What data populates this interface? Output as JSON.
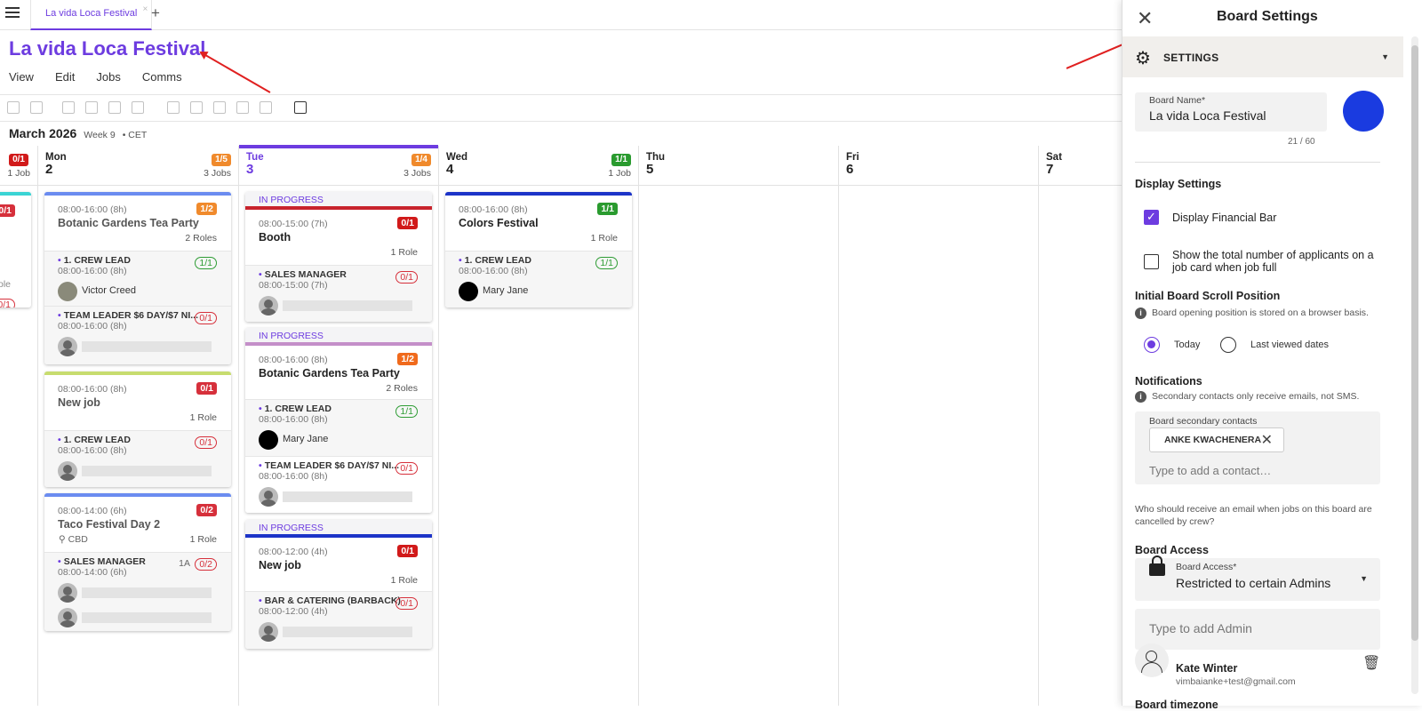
{
  "tab": {
    "label": "La vida Loca Festival",
    "close": "×",
    "add": "+"
  },
  "board": {
    "title": "La vida Loca Festival"
  },
  "menu": [
    "View",
    "Edit",
    "Jobs",
    "Comms"
  ],
  "datebar": {
    "month": "March 2026",
    "week": "Week 9",
    "tz": "• CET"
  },
  "days": [
    {
      "name": "",
      "num": "",
      "badge": "0/1",
      "badge_color": "#d11a1a",
      "jobs": "1 Job"
    },
    {
      "name": "Mon",
      "num": "2",
      "badge": "1/5",
      "badge_color": "#f08a2c",
      "jobs": "3 Jobs"
    },
    {
      "name": "Tue",
      "num": "3",
      "badge": "1/4",
      "badge_color": "#f08a2c",
      "jobs": "3 Jobs"
    },
    {
      "name": "Wed",
      "num": "4",
      "badge": "1/1",
      "badge_color": "#2a9b2f",
      "jobs": "1 Job"
    },
    {
      "name": "Thu",
      "num": "5"
    },
    {
      "name": "Fri",
      "num": "6"
    },
    {
      "name": "Sat",
      "num": "7"
    }
  ],
  "prev_col": {
    "badge": "0/1",
    "role": "ole",
    "rbadge": "0/1"
  },
  "mon": {
    "job1": {
      "time": "08:00-16:00 (8h)",
      "title": "Botanic Gardens Tea Party",
      "badge": "1/2",
      "roles": "2 Roles",
      "r1": {
        "name": "1. CREW LEAD",
        "time": "08:00-16:00 (8h)",
        "badge": "1/1",
        "person": "Victor Creed"
      },
      "r2": {
        "name": "TEAM LEADER $6 DAY/$7 NI...",
        "time": "08:00-16:00 (8h)",
        "badge": "0/1"
      }
    },
    "job2": {
      "time": "08:00-16:00 (8h)",
      "title": "New job",
      "badge": "0/1",
      "roles": "1 Role",
      "r1": {
        "name": "1. CREW LEAD",
        "time": "08:00-16:00 (8h)",
        "badge": "0/1"
      }
    },
    "job3": {
      "time": "08:00-14:00 (6h)",
      "title": "Taco Festival Day 2",
      "badge": "0/2",
      "loc": "CBD",
      "roles": "1 Role",
      "r1": {
        "name": "SALES MANAGER",
        "time": "08:00-14:00 (6h)",
        "badge": "0/2",
        "count": "1A"
      }
    }
  },
  "tue": {
    "job1": {
      "status": "IN PROGRESS",
      "time": "08:00-15:00 (7h)",
      "title": "Booth",
      "badge": "0/1",
      "roles": "1 Role",
      "r1": {
        "name": "SALES MANAGER",
        "time": "08:00-15:00 (7h)",
        "badge": "0/1"
      }
    },
    "job2": {
      "status": "IN PROGRESS",
      "time": "08:00-16:00 (8h)",
      "title": "Botanic Gardens Tea Party",
      "badge": "1/2",
      "roles": "2 Roles",
      "r1": {
        "name": "1. CREW LEAD",
        "time": "08:00-16:00 (8h)",
        "badge": "1/1",
        "person": "Mary Jane"
      },
      "r2": {
        "name": "TEAM LEADER $6 DAY/$7 NI...",
        "time": "08:00-16:00 (8h)",
        "badge": "0/1"
      }
    },
    "job3": {
      "status": "IN PROGRESS",
      "time": "08:00-12:00 (4h)",
      "title": "New job",
      "badge": "0/1",
      "roles": "1 Role",
      "r1": {
        "name": "BAR & CATERING (BARBACK)",
        "time": "08:00-12:00 (4h)",
        "badge": "0/1"
      }
    }
  },
  "wed": {
    "job1": {
      "time": "08:00-16:00 (8h)",
      "title": "Colors Festival",
      "badge": "1/1",
      "roles": "1 Role",
      "r1": {
        "name": "1. CREW LEAD",
        "time": "08:00-16:00 (8h)",
        "badge": "1/1",
        "person": "Mary Jane"
      }
    }
  },
  "panel": {
    "title": "Board Settings",
    "section": "SETTINGS",
    "board_name_label": "Board Name*",
    "board_name": "La vida Loca Festival",
    "counter": "21 / 60",
    "board_color": "#1a3be0",
    "display_settings": "Display Financial Bar",
    "display_heading": "Display Settings",
    "applicants": "Show the total number of applicants on a job card when job full",
    "scroll_heading": "Initial Board Scroll Position",
    "scroll_info": "Board opening position is stored on a browser basis.",
    "radio_today": "Today",
    "radio_last": "Last viewed dates",
    "notif_heading": "Notifications",
    "notif_info": "Secondary contacts only receive emails, not SMS.",
    "contacts_label": "Board secondary contacts",
    "contact_chip": "ANKE KWACHENERA",
    "contact_placeholder": "Type to add a contact…",
    "cancel_question": "Who should receive an email when jobs on this board are cancelled by crew?",
    "access_heading": "Board Access",
    "access_label": "Board Access*",
    "access_value": "Restricted to certain Admins",
    "admin_placeholder": "Type to add Admin",
    "admin_name": "Kate Winter",
    "admin_email": "vimbaianke+test@gmail.com",
    "timezone_heading": "Board timezone"
  }
}
